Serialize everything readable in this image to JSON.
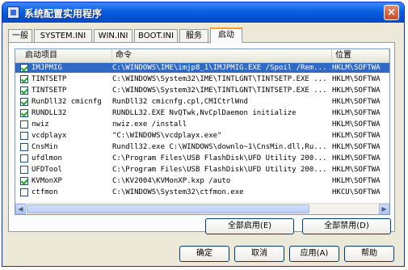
{
  "window": {
    "title": "系统配置实用程序",
    "close_glyph": "×"
  },
  "tabs": [
    {
      "label": "一般"
    },
    {
      "label": "SYSTEM.INI"
    },
    {
      "label": "WIN.INI"
    },
    {
      "label": "BOOT.INI"
    },
    {
      "label": "服务"
    },
    {
      "label": "启动"
    }
  ],
  "active_tab": "启动",
  "columns": {
    "item": "启动项目",
    "command": "命令",
    "location": "位置"
  },
  "rows": [
    {
      "checked": true,
      "item": "IMJPMIG",
      "command": "C:\\WINDOWS\\IME\\imjp8_1\\IMJPMIG.EXE /Spoil /Rem...",
      "location": "HKLM\\SOFTWA"
    },
    {
      "checked": true,
      "item": "TINTSETP",
      "command": "C:\\WINDOWS\\System32\\IME\\TINTLGNT\\TINTSETP.EXE ...",
      "location": "HKLM\\SOFTWA"
    },
    {
      "checked": true,
      "item": "TINTSETP",
      "command": "C:\\WINDOWS\\System32\\IME\\TINTLGNT\\TINTSETP.EXE ...",
      "location": "HKLM\\SOFTWA"
    },
    {
      "checked": true,
      "item": "RunDll32 cmicnfg",
      "command": "RunDll32 cmicnfg.cpl,CMICtrlWnd",
      "location": "HKLM\\SOFTWA"
    },
    {
      "checked": true,
      "item": "RUNDLL32",
      "command": "RUNDLL32.EXE NvQTwk,NvCplDaemon initialize",
      "location": "HKLM\\SOFTWA"
    },
    {
      "checked": false,
      "item": "nwiz",
      "command": "nwiz.exe /install",
      "location": "HKLM\\SOFTWA"
    },
    {
      "checked": false,
      "item": "vcdplayx",
      "command": "\"C:\\WINDOWS\\vcdplayx.exe\"",
      "location": "HKLM\\SOFTWA"
    },
    {
      "checked": false,
      "item": "CnsMin",
      "command": "Rundll32.exe C:\\WINDOWS\\downlo~1\\CnsMin.dll,Ru...",
      "location": "HKLM\\SOFTWA"
    },
    {
      "checked": false,
      "item": "ufdlmon",
      "command": "C:\\Program Files\\USB FlashDisk\\UFD Utility 200...",
      "location": "HKLM\\SOFTWA"
    },
    {
      "checked": false,
      "item": "UFDTool",
      "command": "C:\\Program Files\\USB FlashDisk\\UFD Utility 200...",
      "location": "HKLM\\SOFTWA"
    },
    {
      "checked": true,
      "item": "KVMonXP",
      "command": "C:\\KV2004\\KVMonXP.kxp /auto",
      "location": "HKLM\\SOFTWA"
    },
    {
      "checked": false,
      "item": "ctfmon",
      "command": "C:\\WINDOWS\\System32\\ctfmon.exe",
      "location": "HKCU\\SOFTWA"
    }
  ],
  "selected_row": 0,
  "buttons": {
    "enable_all": "全部启用(E)",
    "disable_all": "全部禁用(D)",
    "ok": "确定",
    "cancel": "取消",
    "apply": "应用(A)",
    "help": "帮助"
  }
}
